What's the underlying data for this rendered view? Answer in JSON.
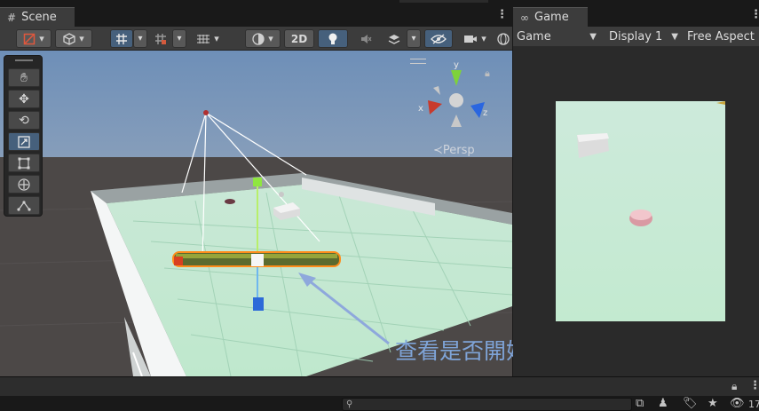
{
  "tabs": {
    "scene": {
      "icon": "#",
      "label": "Scene"
    },
    "game": {
      "icon": "∞",
      "label": "Game"
    }
  },
  "scene_toolbar": {
    "mode_2d": "2D"
  },
  "game_toolbar": {
    "mode": "Game",
    "display": "Display 1",
    "aspect": "Free Aspect"
  },
  "scene_view": {
    "projection": "≺Persp",
    "gizmo_axes": {
      "x": "x",
      "y": "y",
      "z": "z"
    },
    "annotation": "查看是否開始旋轉"
  },
  "tools": [
    "hand-tool",
    "move-tool",
    "rotate-tool",
    "scale-tool",
    "rect-tool",
    "transform-tool",
    "custom-tool"
  ],
  "bottom": {
    "count": "17"
  },
  "colors": {
    "panel": "#3c3c3c",
    "active": "#46607c",
    "annotation": "#7fa4d8",
    "selection": "#ff8c1a"
  }
}
